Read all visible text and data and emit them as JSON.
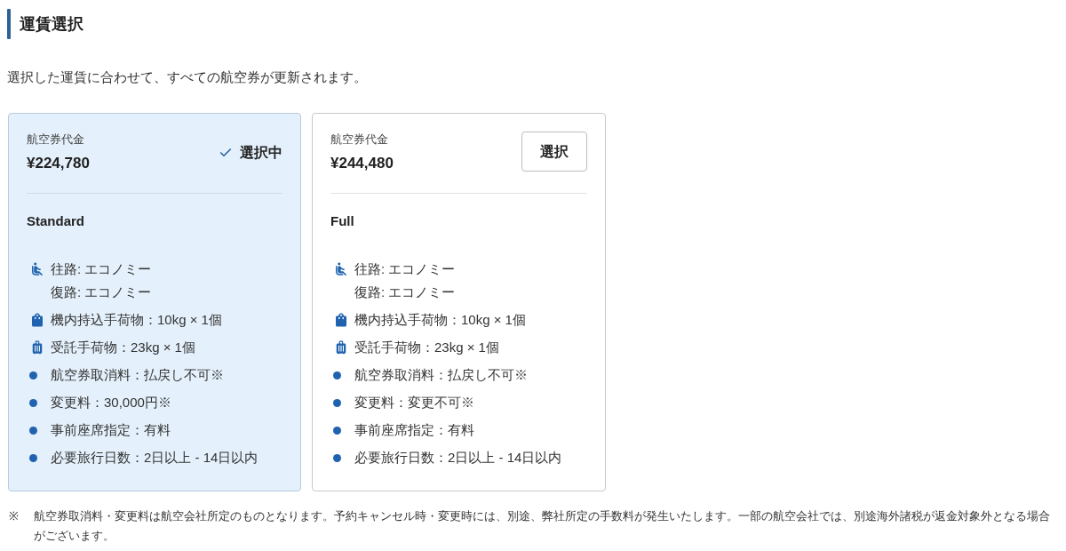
{
  "section": {
    "title": "運賃選択",
    "description": "選択した運賃に合わせて、すべての航空券が更新されます。"
  },
  "fares": [
    {
      "selected": true,
      "price_label": "航空券代金",
      "price": "¥224,780",
      "action_label": "選択中",
      "name": "Standard",
      "features": [
        {
          "kind": "seat",
          "lines": [
            "往路: エコノミー",
            "復路: エコノミー"
          ]
        },
        {
          "kind": "carry_on",
          "lines": [
            "機内持込手荷物：10kg × 1個"
          ]
        },
        {
          "kind": "checked_bag",
          "lines": [
            "受託手荷物：23kg × 1個"
          ]
        },
        {
          "kind": "bullet",
          "lines": [
            "航空券取消料：払戻し不可※"
          ]
        },
        {
          "kind": "bullet",
          "lines": [
            "変更料：30,000円※"
          ]
        },
        {
          "kind": "bullet",
          "lines": [
            "事前座席指定：有料"
          ]
        },
        {
          "kind": "bullet",
          "lines": [
            "必要旅行日数：2日以上 - 14日以内"
          ]
        }
      ]
    },
    {
      "selected": false,
      "price_label": "航空券代金",
      "price": "¥244,480",
      "action_label": "選択",
      "name": "Full",
      "features": [
        {
          "kind": "seat",
          "lines": [
            "往路: エコノミー",
            "復路: エコノミー"
          ]
        },
        {
          "kind": "carry_on",
          "lines": [
            "機内持込手荷物：10kg × 1個"
          ]
        },
        {
          "kind": "checked_bag",
          "lines": [
            "受託手荷物：23kg × 1個"
          ]
        },
        {
          "kind": "bullet",
          "lines": [
            "航空券取消料：払戻し不可※"
          ]
        },
        {
          "kind": "bullet",
          "lines": [
            "変更料：変更不可※"
          ]
        },
        {
          "kind": "bullet",
          "lines": [
            "事前座席指定：有料"
          ]
        },
        {
          "kind": "bullet",
          "lines": [
            "必要旅行日数：2日以上 - 14日以内"
          ]
        }
      ]
    }
  ],
  "note": {
    "mark": "※",
    "text": "航空券取消料・変更料は航空会社所定のものとなります。予約キャンセル時・変更時には、別途、弊社所定の手数料が発生いたします。一部の航空会社では、別途海外諸税が返金対象外となる場合がございます。"
  }
}
